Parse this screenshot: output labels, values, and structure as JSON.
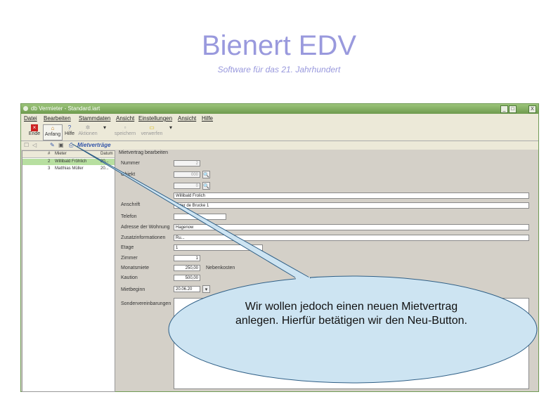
{
  "slide": {
    "title": "Bienert EDV",
    "subtitle": "Software für das 21. Jahrhundert"
  },
  "window": {
    "title": "db Vermieter - Standard.iart",
    "min": "_",
    "max": "□",
    "close": "X"
  },
  "menu": [
    "Datei",
    "Bearbeiten",
    "Stammdaten",
    "Ansicht",
    "Einstellungen",
    "Ansicht",
    "Hilfe"
  ],
  "toolbar": {
    "ende": "Ende",
    "anfang": "Anfang",
    "hilfe": "Hilfe",
    "aktionen": "Aktionen",
    "speichern": "speichern",
    "verwerfen": "verwerfen"
  },
  "subbar": {
    "label": "Mietverträge"
  },
  "list": {
    "headers": {
      "nr": "#",
      "mieter": "Mieter",
      "datum": "Datum"
    },
    "rows": [
      {
        "nr": "2",
        "name": "Willibald Fröhlich",
        "date": "20..."
      },
      {
        "nr": "3",
        "name": "Matthias Müller",
        "date": "20..."
      }
    ]
  },
  "form": {
    "group_title": "Mietvertrag bearbeiten",
    "labels": {
      "nummer": "Nummer",
      "objekt": "Objekt",
      "anschrift": "Anschrift",
      "telefon": "Telefon",
      "adresse_wohnung": "Adresse der Wohnung",
      "zusatz": "Zusatzinformationen",
      "etage": "Etage",
      "zimmer": "Zimmer",
      "monatsmiete": "Monatsmiete",
      "kaution": "Kaution",
      "mietbeginn": "Mietbeginn",
      "sondervereinbarungen": "Sondervereinbarungen",
      "nebenkosten": "Nebenkosten"
    },
    "values": {
      "nummer": "2",
      "objekt": "000",
      "objekt2": "0",
      "name": "Willibald Frolich",
      "anschrift": "unter de Brucke 1",
      "adresse_wohnung": "Hagenow",
      "zusatz": "Ru...",
      "etage": "1",
      "zimmer": "1",
      "monatsmiete": "250,00",
      "kaution": "500,00",
      "mietbeginn": "20.06.20"
    }
  },
  "callout": {
    "text": "Wir wollen jedoch einen neuen Mietvertrag anlegen. Hierfür betätigen wir den Neu-Button."
  },
  "colors": {
    "title": "#9999dd",
    "titlebar": "#7aa65a",
    "bubble_fill": "#cde4f2",
    "bubble_stroke": "#2f5f86",
    "selection": "#b7dfa0"
  }
}
